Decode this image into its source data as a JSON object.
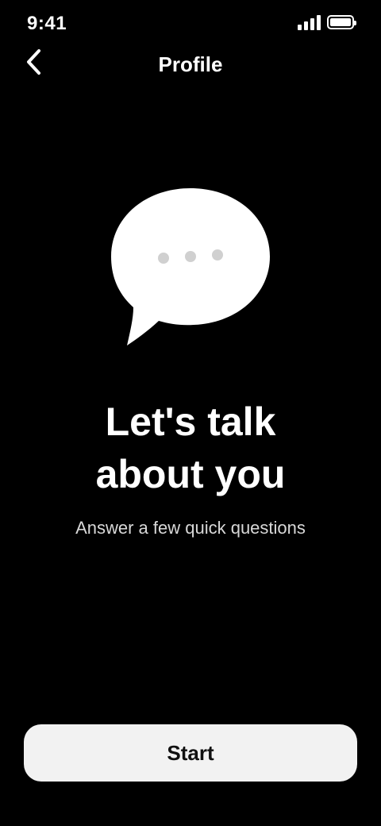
{
  "status_bar": {
    "time": "9:41",
    "battery_level": 1.0
  },
  "nav": {
    "back_icon": "chevron-left-icon",
    "title": "Profile"
  },
  "hero": {
    "icon": "chat-bubble-icon",
    "headline": "Let's talk about you",
    "subtitle": "Answer a few quick questions"
  },
  "footer": {
    "button_label": "Start"
  },
  "colors": {
    "background": "#000000",
    "foreground": "#ffffff",
    "button_bg": "#f2f2f2",
    "button_text": "#111111"
  }
}
